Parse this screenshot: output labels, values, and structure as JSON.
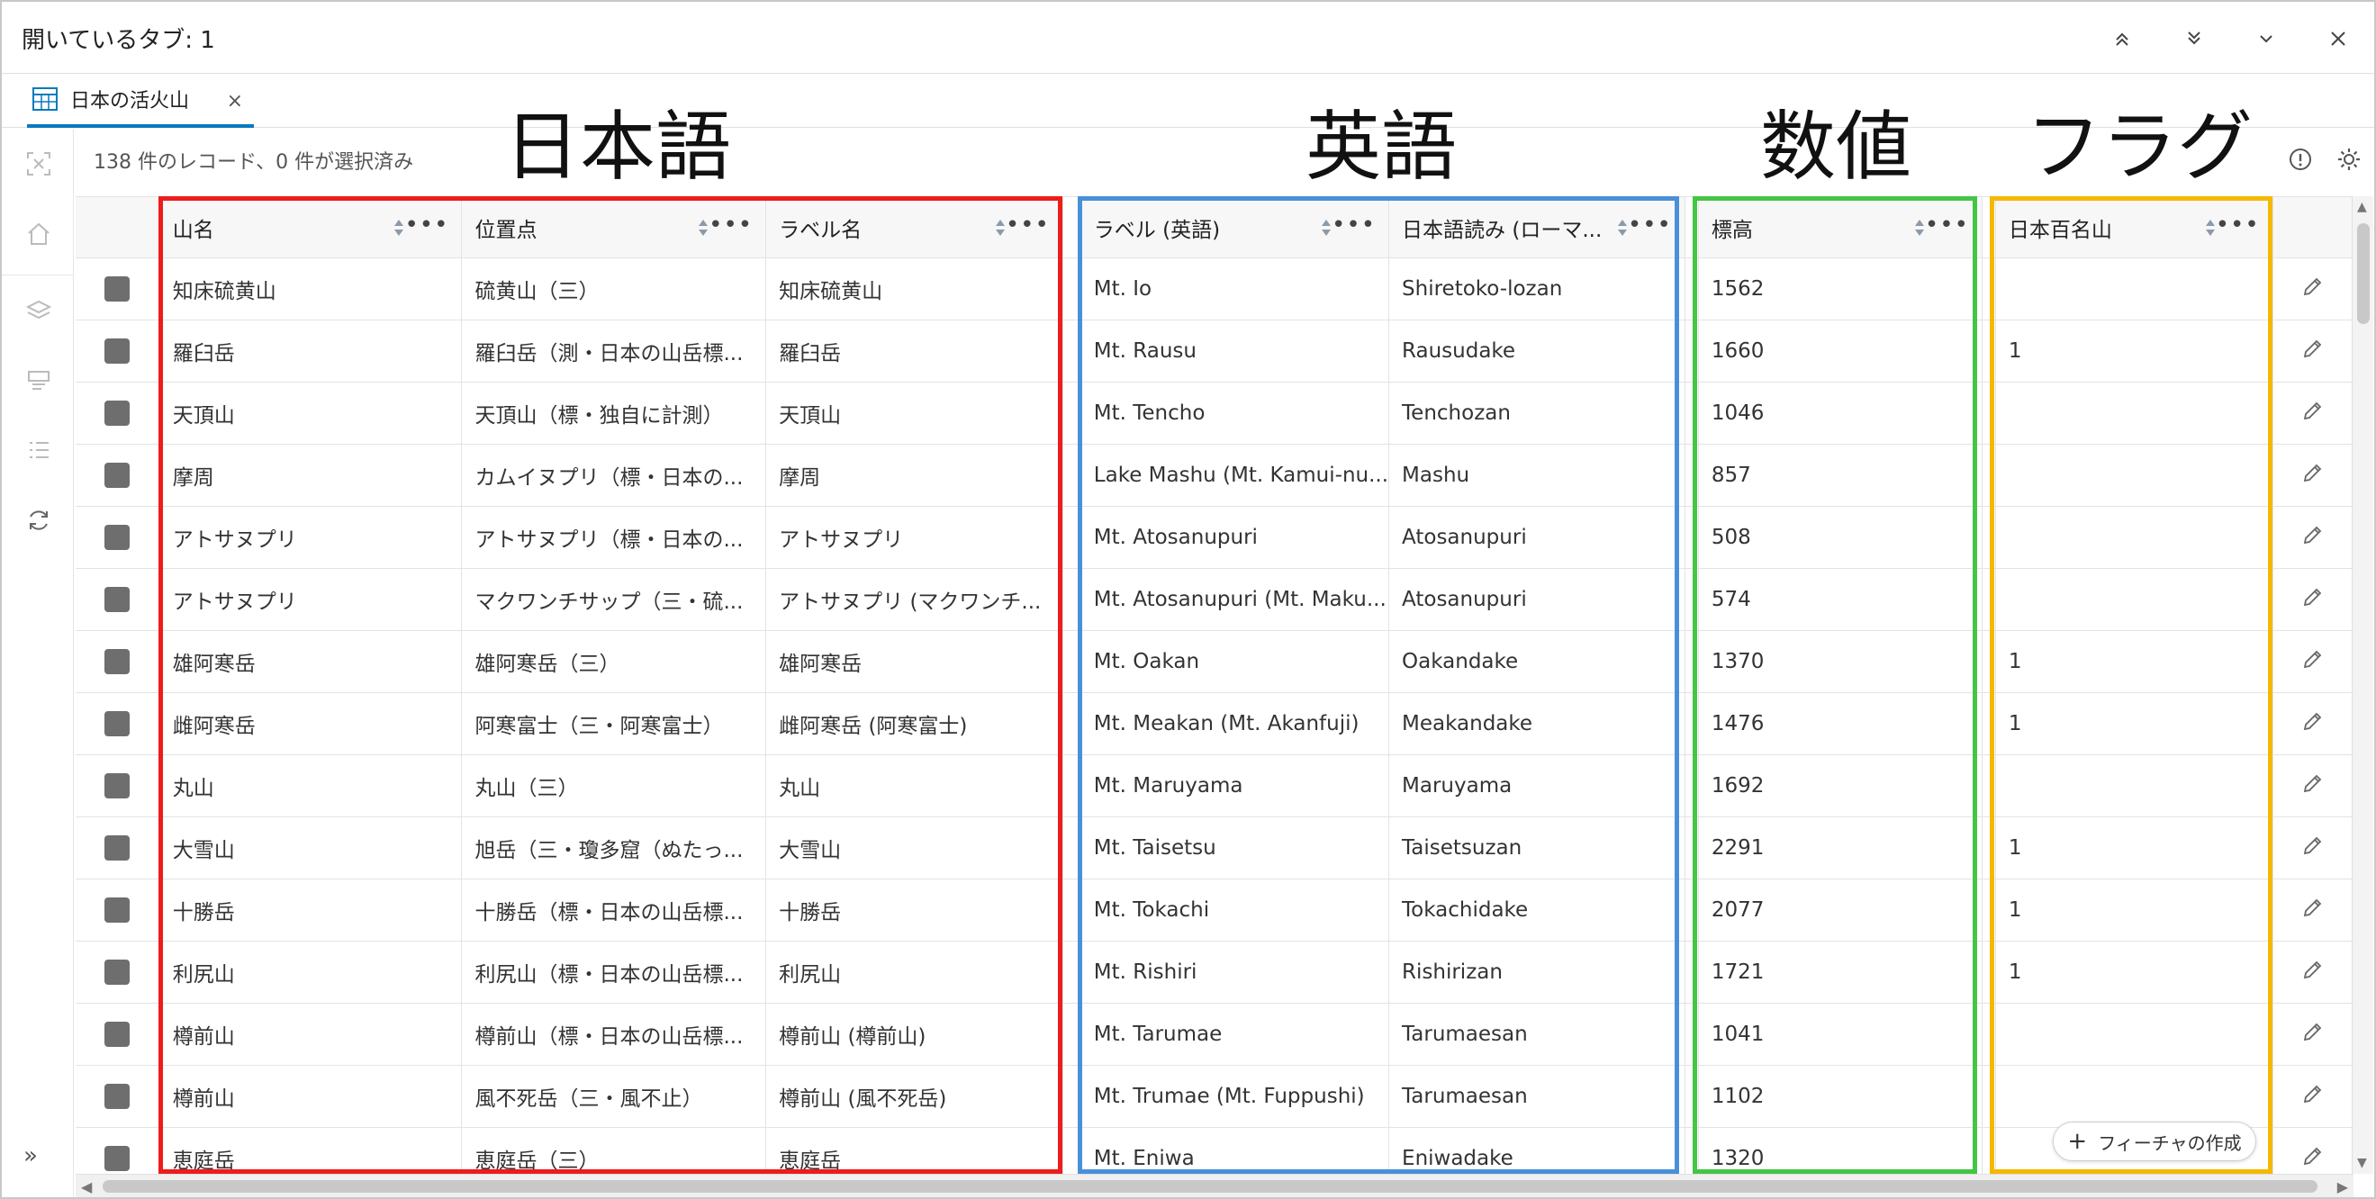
{
  "window": {
    "title": "開いているタブ: 1"
  },
  "tab": {
    "label": "日本の活火山",
    "close_glyph": "×"
  },
  "status": {
    "text": "138 件のレコード、0 件が選択済み"
  },
  "groups": {
    "japanese": "日本語",
    "english": "英語",
    "numeric": "数値",
    "flag": "フラグ"
  },
  "group_colors": {
    "japanese": "#ee1c1c",
    "english": "#4a90d9",
    "numeric": "#44c544",
    "flag": "#f5b800"
  },
  "columns": {
    "yamana": "山名",
    "iten": "位置点",
    "label_ja": "ラベル名",
    "label_en": "ラベル (英語)",
    "romaji": "日本語読み (ローマ...",
    "elevation": "標高",
    "hyakumeizan": "日本百名山"
  },
  "header_more": "•••",
  "rows": [
    {
      "yamana": "知床硫黄山",
      "iten": "硫黄山（三）",
      "label_ja": "知床硫黄山",
      "label_en": "Mt. Io",
      "romaji": "Shiretoko-lozan",
      "elevation": "1562",
      "hyakumeizan": ""
    },
    {
      "yamana": "羅臼岳",
      "iten": "羅臼岳（測・日本の山岳標...",
      "label_ja": "羅臼岳",
      "label_en": "Mt. Rausu",
      "romaji": "Rausudake",
      "elevation": "1660",
      "hyakumeizan": "1"
    },
    {
      "yamana": "天頂山",
      "iten": "天頂山（標・独自に計測）",
      "label_ja": "天頂山",
      "label_en": "Mt. Tencho",
      "romaji": "Tenchozan",
      "elevation": "1046",
      "hyakumeizan": ""
    },
    {
      "yamana": "摩周",
      "iten": "カムイヌプリ（標・日本の...",
      "label_ja": "摩周",
      "label_en": "Lake Mashu (Mt. Kamui-nu...",
      "romaji": "Mashu",
      "elevation": "857",
      "hyakumeizan": ""
    },
    {
      "yamana": "アトサヌプリ",
      "iten": "アトサヌプリ（標・日本の...",
      "label_ja": "アトサヌプリ",
      "label_en": "Mt. Atosanupuri",
      "romaji": "Atosanupuri",
      "elevation": "508",
      "hyakumeizan": ""
    },
    {
      "yamana": "アトサヌプリ",
      "iten": "マクワンチサップ（三・硫...",
      "label_ja": "アトサヌプリ (マクワンチ...",
      "label_en": "Mt. Atosanupuri (Mt. Maku...",
      "romaji": "Atosanupuri",
      "elevation": "574",
      "hyakumeizan": ""
    },
    {
      "yamana": "雄阿寒岳",
      "iten": "雄阿寒岳（三）",
      "label_ja": "雄阿寒岳",
      "label_en": "Mt. Oakan",
      "romaji": "Oakandake",
      "elevation": "1370",
      "hyakumeizan": "1"
    },
    {
      "yamana": "雌阿寒岳",
      "iten": "阿寒富士（三・阿寒富士）",
      "label_ja": "雌阿寒岳 (阿寒富士)",
      "label_en": "Mt. Meakan (Mt. Akanfuji)",
      "romaji": "Meakandake",
      "elevation": "1476",
      "hyakumeizan": "1"
    },
    {
      "yamana": "丸山",
      "iten": "丸山（三）",
      "label_ja": "丸山",
      "label_en": "Mt. Maruyama",
      "romaji": "Maruyama",
      "elevation": "1692",
      "hyakumeizan": ""
    },
    {
      "yamana": "大雪山",
      "iten": "旭岳（三・瓊多窟（ぬたっ...",
      "label_ja": "大雪山",
      "label_en": "Mt. Taisetsu",
      "romaji": "Taisetsuzan",
      "elevation": "2291",
      "hyakumeizan": "1"
    },
    {
      "yamana": "十勝岳",
      "iten": "十勝岳（標・日本の山岳標...",
      "label_ja": "十勝岳",
      "label_en": "Mt. Tokachi",
      "romaji": "Tokachidake",
      "elevation": "2077",
      "hyakumeizan": "1"
    },
    {
      "yamana": "利尻山",
      "iten": "利尻山（標・日本の山岳標...",
      "label_ja": "利尻山",
      "label_en": "Mt. Rishiri",
      "romaji": "Rishirizan",
      "elevation": "1721",
      "hyakumeizan": "1"
    },
    {
      "yamana": "樽前山",
      "iten": "樽前山（標・日本の山岳標...",
      "label_ja": "樽前山 (樽前山)",
      "label_en": "Mt. Tarumae",
      "romaji": "Tarumaesan",
      "elevation": "1041",
      "hyakumeizan": ""
    },
    {
      "yamana": "樽前山",
      "iten": "風不死岳（三・風不止）",
      "label_ja": "樽前山 (風不死岳)",
      "label_en": "Mt. Trumae (Mt. Fuppushi)",
      "romaji": "Tarumaesan",
      "elevation": "1102",
      "hyakumeizan": ""
    },
    {
      "yamana": "恵庭岳",
      "iten": "恵庭岳（三）",
      "label_ja": "恵庭岳",
      "label_en": "Mt. Eniwa",
      "romaji": "Eniwadake",
      "elevation": "1320",
      "hyakumeizan": ""
    }
  ],
  "create_button": {
    "label": "フィーチャの作成",
    "plus": "+"
  },
  "rail": {
    "expand_glyph": "»"
  },
  "icons": {
    "table": "table-icon",
    "collapse_up": "chevrons-up-icon",
    "expand_down": "chevrons-down-icon",
    "minimize": "chevron-down-icon",
    "close": "close-icon",
    "zoom": "zoom-to-selection-icon",
    "home": "home-icon",
    "layers": "layers-icon",
    "filter": "filter-icon",
    "list": "list-icon",
    "refresh": "refresh-icon",
    "info": "info-icon",
    "settings": "gear-icon",
    "edit": "pencil-icon",
    "sort": "sort-icon"
  }
}
